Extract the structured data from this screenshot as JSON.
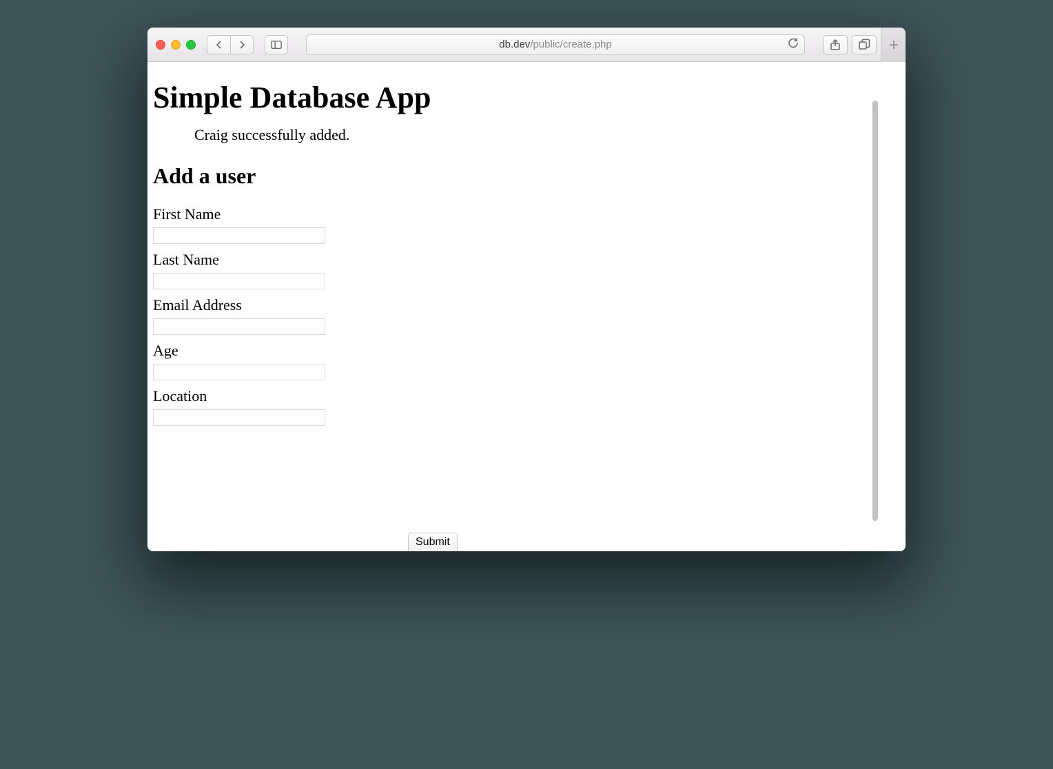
{
  "browser": {
    "url_dark": "db.dev",
    "url_light": "/public/create.php"
  },
  "page": {
    "heading": "Simple Database App",
    "message": "Craig successfully added.",
    "subheading": "Add a user",
    "fields": {
      "first_name": {
        "label": "First Name",
        "value": ""
      },
      "last_name": {
        "label": "Last Name",
        "value": ""
      },
      "email": {
        "label": "Email Address",
        "value": ""
      },
      "age": {
        "label": "Age",
        "value": ""
      },
      "location": {
        "label": "Location",
        "value": ""
      }
    },
    "submit_label": "Submit"
  }
}
